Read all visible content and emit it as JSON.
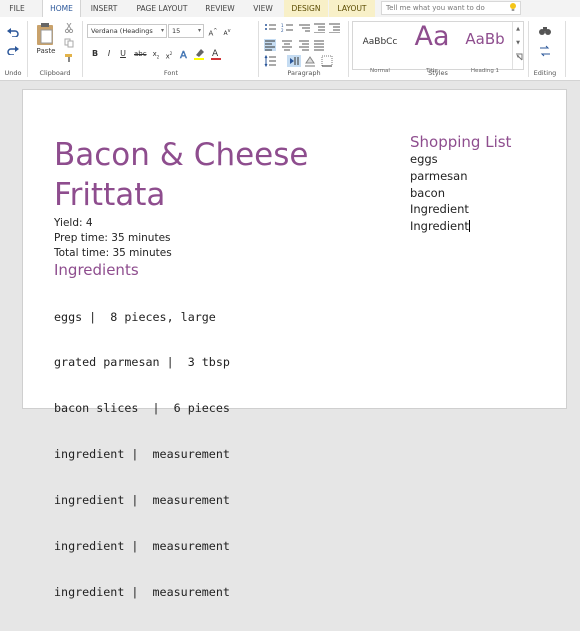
{
  "tabs": [
    {
      "id": "file",
      "label": "FILE"
    },
    {
      "id": "home",
      "label": "HOME"
    },
    {
      "id": "insert",
      "label": "INSERT"
    },
    {
      "id": "page_layout",
      "label": "PAGE LAYOUT"
    },
    {
      "id": "review",
      "label": "REVIEW"
    },
    {
      "id": "view",
      "label": "VIEW"
    },
    {
      "id": "design",
      "label": "DESIGN"
    },
    {
      "id": "layout",
      "label": "LAYOUT"
    }
  ],
  "active_tab": "HOME",
  "tell_me": {
    "placeholder": "Tell me what you want to do"
  },
  "ribbon": {
    "undo_group_label": "Undo",
    "clipboard": {
      "label": "Clipboard",
      "paste_label": "Paste"
    },
    "font": {
      "label": "Font",
      "family": "Verdana (Headings",
      "size": "15"
    },
    "paragraph": {
      "label": "Paragraph"
    },
    "styles": {
      "label": "Styles",
      "items": [
        {
          "sample": "AaBbCc",
          "name": "Normal"
        },
        {
          "sample": "Aa",
          "name": "Title"
        },
        {
          "sample": "AaBb",
          "name": "Heading 1"
        }
      ]
    },
    "editing": {
      "label": "Editing"
    }
  },
  "colors": {
    "accent": "#2b579a",
    "heading": "#8e4d8e",
    "highlight": "#ffff00",
    "font_color": "#d13438"
  },
  "document": {
    "title": "Bacon & Cheese Frittata",
    "yield": "Yield: 4",
    "prep_time": "Prep time: 35 minutes",
    "total_time": "Total time: 35 minutes",
    "ingredients_heading": "Ingredients",
    "ingredients": [
      "eggs |  8 pieces, large",
      "grated parmesan |  3 tbsp",
      "bacon slices  |  6 pieces",
      "ingredient |  measurement",
      "ingredient |  measurement",
      "ingredient |  measurement",
      "ingredient |  measurement"
    ],
    "shopping_heading": "Shopping List",
    "shopping_items": [
      "eggs",
      "parmesan",
      "bacon",
      "Ingredient",
      "Ingredient"
    ]
  }
}
